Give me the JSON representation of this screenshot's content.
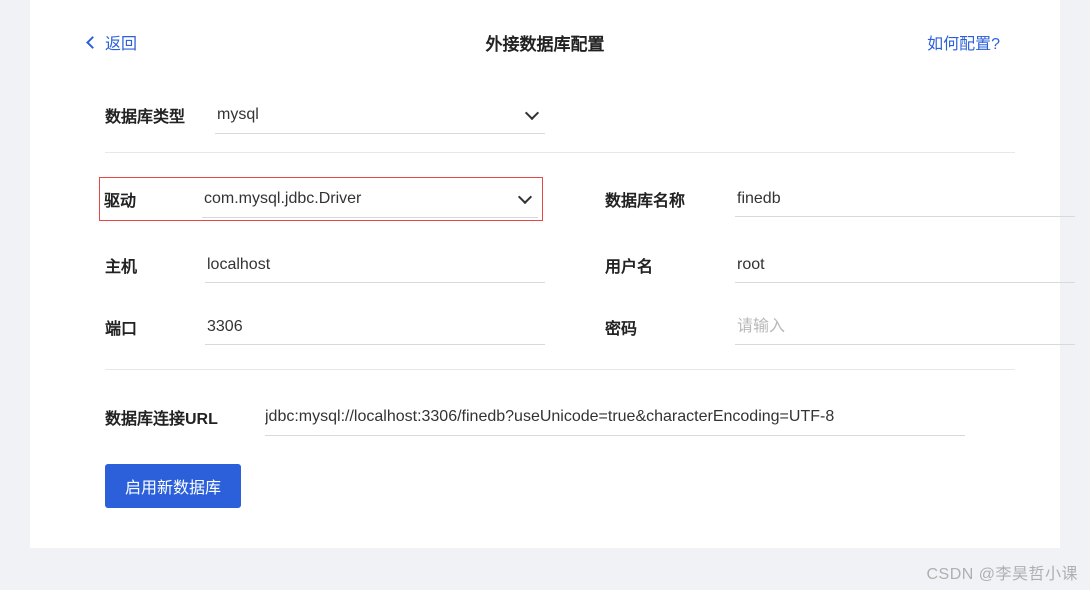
{
  "header": {
    "back_label": "返回",
    "title": "外接数据库配置",
    "help_label": "如何配置?"
  },
  "form": {
    "db_type_label": "数据库类型",
    "db_type_value": "mysql",
    "driver_label": "驱动",
    "driver_value": "com.mysql.jdbc.Driver",
    "db_name_label": "数据库名称",
    "db_name_value": "finedb",
    "host_label": "主机",
    "host_value": "localhost",
    "username_label": "用户名",
    "username_value": "root",
    "port_label": "端口",
    "port_value": "3306",
    "password_label": "密码",
    "password_placeholder": "请输入",
    "url_label": "数据库连接URL",
    "url_value": "jdbc:mysql://localhost:3306/finedb?useUnicode=true&characterEncoding=UTF-8"
  },
  "actions": {
    "enable_btn": "启用新数据库"
  },
  "watermark": "CSDN @李昊哲小课"
}
